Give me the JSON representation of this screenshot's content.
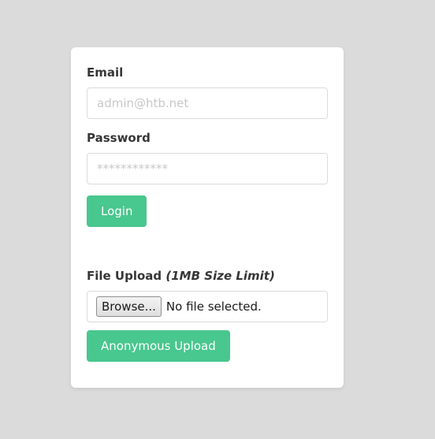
{
  "login": {
    "email_label": "Email",
    "email_placeholder": "admin@htb.net",
    "password_label": "Password",
    "password_placeholder": "************",
    "login_button": "Login"
  },
  "upload": {
    "label": "File Upload",
    "size_limit": "(1MB Size Limit)",
    "browse_button": "Browse...",
    "file_status": "No file selected.",
    "submit_button": "Anonymous Upload"
  },
  "colors": {
    "page_background": "#dbdbdb",
    "accent": "#48c78e"
  }
}
